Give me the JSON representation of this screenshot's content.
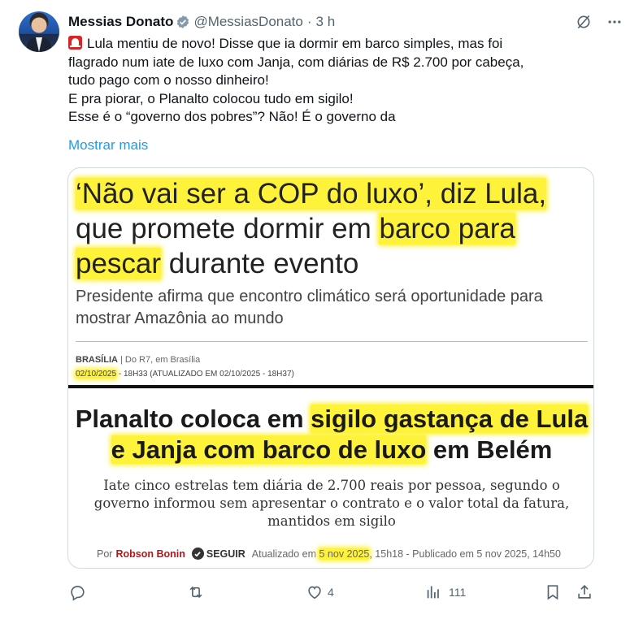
{
  "tweet": {
    "author_name": "Messias Donato",
    "handle": "@MessiasDonato",
    "separator": "·",
    "time": "3 h",
    "lines": [
      "Lula mentiu de novo! Disse que ia dormir em barco simples, mas foi",
      "flagrado num iate de luxo com Janja, com diárias de R$ 2.700 por cabeça,",
      "tudo pago com o nosso dinheiro!",
      "E pra piorar, o Planalto colocou tudo em sigilo!",
      "Esse é o “governo dos pobres”? Não! É o governo da"
    ],
    "show_more": "Mostrar mais"
  },
  "article1": {
    "headline": [
      [
        "‘Não vai ser a COP do luxo’, diz Lula,",
        ""
      ],
      [
        "que promete dormir em ",
        "barco para"
      ],
      [
        "pescar",
        " durante evento"
      ]
    ],
    "subtitle": [
      "Presidente afirma que encontro climático será oportunidade para",
      "mostrar Amazônia ao mundo"
    ],
    "city": "BRASÍLIA",
    "source": " | Do R7, em Brasília",
    "date": "02/10/2025",
    "time_info": " - 18H33 (ATUALIZADO EM 02/10/2025 - 18H37)"
  },
  "article2": {
    "headline_line1_plain": "Planalto coloca em ",
    "headline_line1_hl": "sigilo gastança de Lula",
    "headline_line2_hl": "e Janja com barco de luxo",
    "headline_line2_plain": " em Belém",
    "subtitle": [
      "Iate cinco estrelas tem diária de 2.700 reais por pessoa, segundo o",
      "governo informou sem apresentar o contrato e o valor total da fatura,",
      "mantidos em sigilo"
    ],
    "by": "Por",
    "author": "Robson Bonin",
    "follow": "SEGUIR",
    "updated_prefix": "Atualizado em ",
    "updated_date": "5 nov 2025",
    "updated_suffix": ", 15h18 - Publicado em 5 nov 2025, 14h50"
  },
  "actions": {
    "replies": "",
    "reposts": "",
    "likes": "4",
    "views": "111"
  },
  "colors": {
    "accent": "#1d9bf0",
    "verified": "#829aab",
    "highlight": "#fff23a",
    "muted": "#536471"
  },
  "icons": [
    "verified-badge-icon",
    "grok-icon",
    "more-icon",
    "siren-emoji-icon",
    "reply-icon",
    "repost-icon",
    "like-icon",
    "views-icon",
    "bookmark-icon",
    "share-icon"
  ]
}
